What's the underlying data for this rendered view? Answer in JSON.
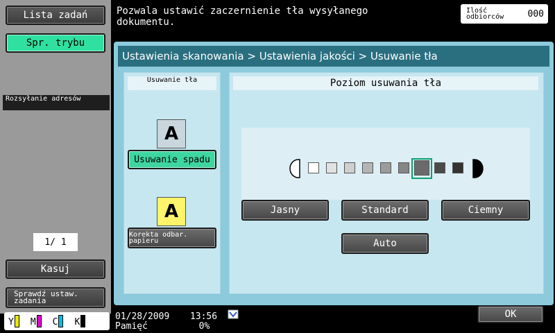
{
  "left_panel": {
    "job_list": "Lista zadań",
    "mode_check": "Spr. trybu",
    "address_bar": "Rozsyłanie adresów",
    "pager": "1/ 1",
    "delete": "Kasuj",
    "check_job": "Sprawdź ustaw. zadania",
    "toner": [
      "Y",
      "M",
      "C",
      "K"
    ],
    "toner_colors": [
      "#e8e800",
      "#e000d0",
      "#00c0e0",
      "#000000"
    ]
  },
  "top": {
    "message": "Pozwala ustawić zaczernienie tła wysyłanego dokumentu.",
    "recipients_label": "Ilość odbiorców",
    "recipients_count": "000"
  },
  "main": {
    "breadcrumb": "Ustawienia skanowania > Ustawienia jakości  > Usuwanie tła",
    "left_header": "Usuwanie tła",
    "icon_letter": "A",
    "bleed_removal": "Usuwanie spadu",
    "paper_correction": "Korekta odbar. papieru",
    "right_header": "Poziom usuwania tła",
    "level_selected_index": 7,
    "level_count": 9,
    "light": "Jasny",
    "standard": "Standard",
    "dark": "Ciemny",
    "auto": "Auto"
  },
  "status": {
    "date": "01/28/2009",
    "time": "13:56",
    "memory_label": "Pamięć",
    "memory_value": "0%"
  },
  "ok": "OK"
}
